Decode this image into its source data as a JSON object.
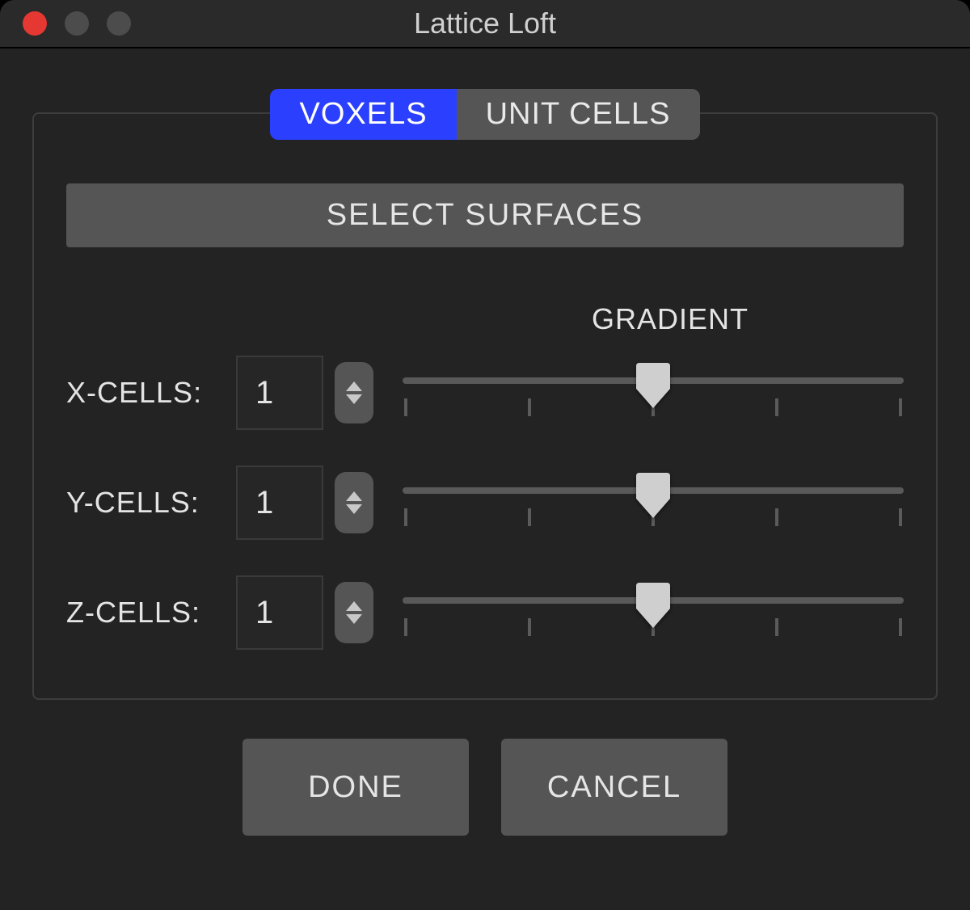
{
  "window": {
    "title": "Lattice Loft"
  },
  "tabs": {
    "voxels": "VOXELS",
    "unit_cells": "UNIT CELLS"
  },
  "panel": {
    "select_surfaces": "SELECT SURFACES",
    "gradient_label": "GRADIENT",
    "rows": {
      "x": {
        "label": "X-CELLS:",
        "value": "1"
      },
      "y": {
        "label": "Y-CELLS:",
        "value": "1"
      },
      "z": {
        "label": "Z-CELLS:",
        "value": "1"
      }
    }
  },
  "footer": {
    "done": "DONE",
    "cancel": "CANCEL"
  }
}
